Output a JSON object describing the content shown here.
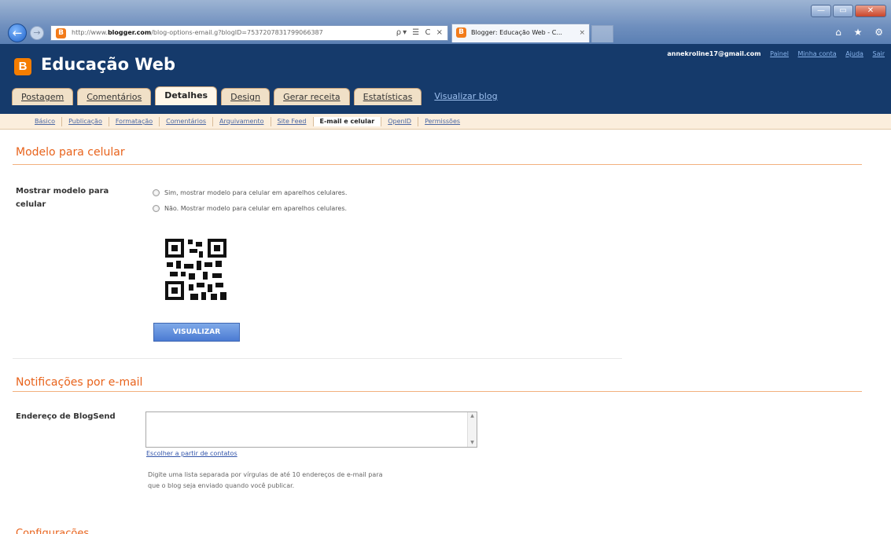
{
  "browser": {
    "url_prefix": "http://www.",
    "url_domain": "blogger.com",
    "url_rest": "/blog-options-email.g?blogID=7537207831799066387",
    "tab_title": "Blogger: Educação Web - C...",
    "tab_close": "×",
    "back": "←",
    "forward": "→",
    "address_tools": "ρ▾ ☰ C ×",
    "window_buttons": [
      "—",
      "▭",
      "✕"
    ],
    "toolbar_icons": "⌂ ★ ⚙"
  },
  "header": {
    "logo_letter": "B",
    "blog_title": "Educação Web",
    "user_email": "annekroline17@gmail.com",
    "links": [
      "Painel",
      "Minha conta",
      "Ajuda",
      "Sair"
    ]
  },
  "main_tabs": [
    "Postagem",
    "Comentários",
    "Detalhes",
    "Design",
    "Gerar receita",
    "Estatísticas"
  ],
  "main_tab_active": "Detalhes",
  "view_blog": "Visualizar blog",
  "sub_tabs": [
    "Básico",
    "Publicação",
    "Formatação",
    "Comentários",
    "Arquivamento",
    "Site Feed",
    "E-mail e celular",
    "OpenID",
    "Permissões"
  ],
  "sub_tab_active": "E-mail e celular",
  "mobile": {
    "title": "Modelo para celular",
    "label_line1": "Mostrar modelo para",
    "label_line2": "celular",
    "option_yes": "Sim, mostrar modelo para celular em aparelhos celulares.",
    "option_no": "Não. Mostrar modelo para celular em aparelhos celulares.",
    "preview_button": "VISUALIZAR"
  },
  "email": {
    "title": "Notificações por e-mail",
    "label": "Endereço de BlogSend",
    "value": "",
    "contacts_link": "Escolher a partir de contatos",
    "help_line1": "Digite uma lista separada por vírgulas de até 10 endereços de e-mail para",
    "help_line2": "que o blog seja enviado quando você publicar."
  },
  "next_section_partial": "Configurações"
}
